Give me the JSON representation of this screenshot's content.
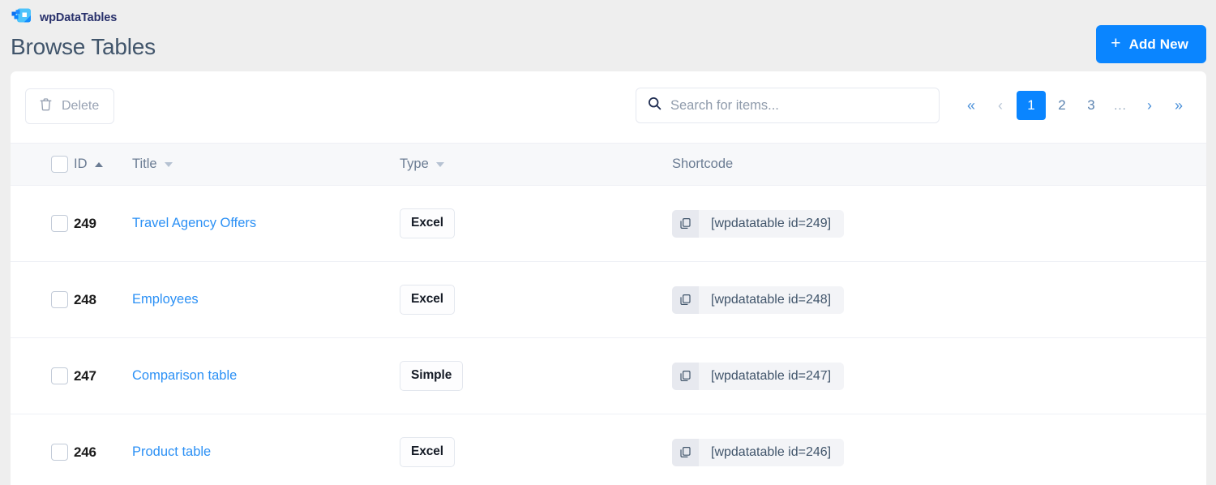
{
  "brand": {
    "name": "wpDataTables",
    "logo_icon": "wpdatatables-logo-icon",
    "accent_color": "#0a85ff",
    "brand_text_color": "#28306b"
  },
  "header": {
    "page_title": "Browse Tables",
    "add_new_label": "Add New",
    "add_new_icon": "plus-icon"
  },
  "toolbar": {
    "delete_label": "Delete",
    "delete_icon": "trash-icon",
    "search": {
      "icon": "search-icon",
      "placeholder": "Search for items...",
      "value": ""
    },
    "pagination": {
      "first_label": "«",
      "prev_label": "‹",
      "next_label": "›",
      "last_label": "»",
      "ellipsis_label": "...",
      "pages": [
        "1",
        "2",
        "3"
      ],
      "active_page": "1",
      "active_color": "#0a85ff"
    }
  },
  "table": {
    "columns": [
      {
        "key": "select",
        "label": "",
        "sort": "none"
      },
      {
        "key": "id",
        "label": "ID",
        "sort": "asc"
      },
      {
        "key": "title",
        "label": "Title",
        "sort": "desc"
      },
      {
        "key": "type",
        "label": "Type",
        "sort": "desc"
      },
      {
        "key": "shortcode",
        "label": "Shortcode",
        "sort": "none"
      }
    ],
    "select_all_checked": false,
    "copy_icon": "copy-icon",
    "rows": [
      {
        "checked": false,
        "id": "249",
        "title": "Travel Agency Offers",
        "type": "Excel",
        "shortcode": "[wpdatatable id=249]"
      },
      {
        "checked": false,
        "id": "248",
        "title": "Employees",
        "type": "Excel",
        "shortcode": "[wpdatatable id=248]"
      },
      {
        "checked": false,
        "id": "247",
        "title": "Comparison table",
        "type": "Simple",
        "shortcode": "[wpdatatable id=247]"
      },
      {
        "checked": false,
        "id": "246",
        "title": "Product table",
        "type": "Excel",
        "shortcode": "[wpdatatable id=246]"
      }
    ]
  }
}
